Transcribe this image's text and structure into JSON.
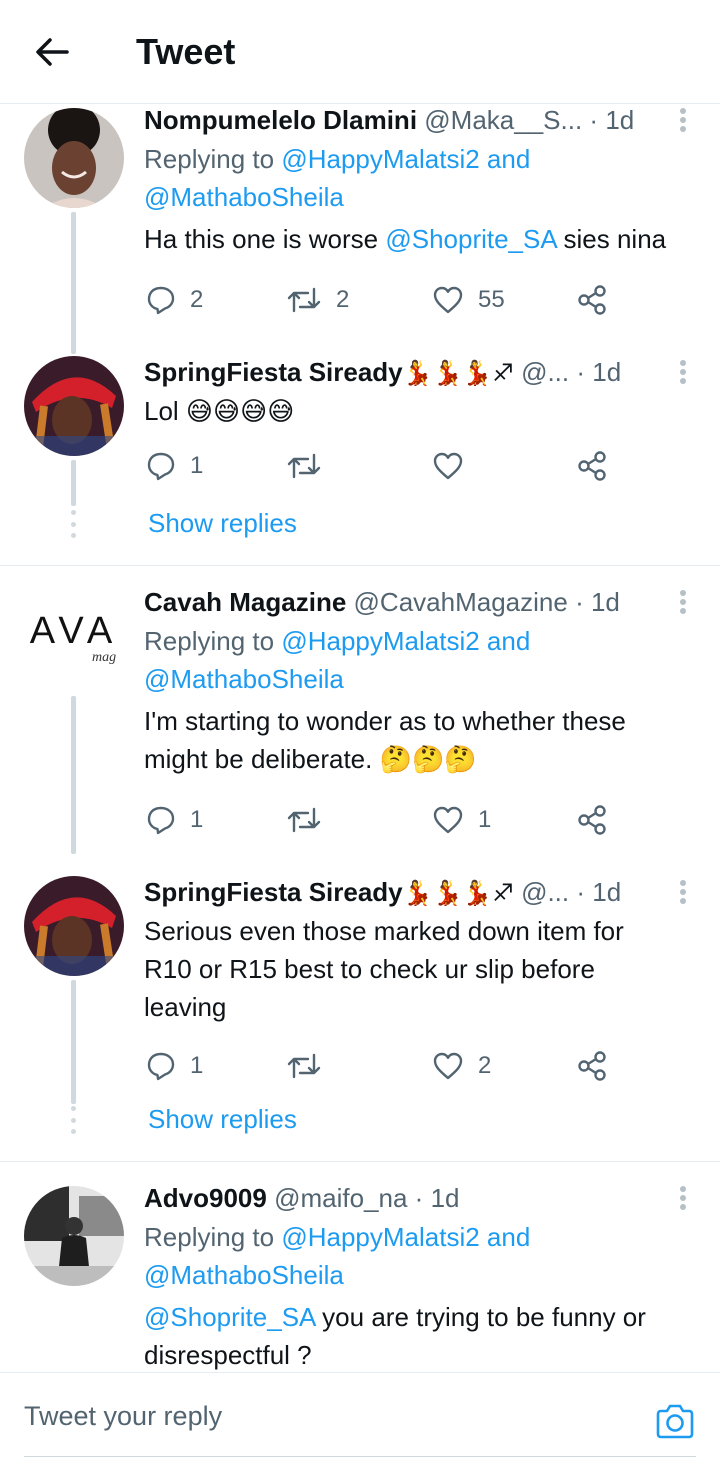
{
  "header": {
    "title": "Tweet"
  },
  "tweets": [
    {
      "name": "Nompumelelo Dlamini",
      "handle": "@Maka__S...",
      "time": "1d",
      "reply_prefix": "Replying to ",
      "reply_1": "@HappyMalatsi2",
      "reply_and": " and",
      "reply_2": "@MathaboSheila",
      "text_a": "Ha this one is worse ",
      "text_mention": "@Shoprite_SA",
      "text_b": " sies nina",
      "replies": "2",
      "retweets": "2",
      "likes": "55"
    },
    {
      "name": "SpringFiesta Siready",
      "emoji": "💃💃💃♐",
      "handle": "@...",
      "time": "1d",
      "text": "Lol 😅😅😅😅",
      "replies": "1",
      "retweets": "",
      "likes": "",
      "show_replies": "Show replies"
    },
    {
      "name": "Cavah Magazine",
      "handle": "@CavahMagazine",
      "time": "1d",
      "avatar_text": "AVA",
      "avatar_sub": "mag",
      "reply_prefix": "Replying to ",
      "reply_1": "@HappyMalatsi2",
      "reply_and": " and",
      "reply_2": "@MathaboSheila",
      "text_1": "I'm starting to wonder as to whether these",
      "text_2": "might be deliberate. 🤔🤔🤔",
      "replies": "1",
      "retweets": "",
      "likes": "1"
    },
    {
      "name": "SpringFiesta Siready",
      "emoji": "💃💃💃♐",
      "handle": "@...",
      "time": "1d",
      "text_1": "Serious even those marked down item for",
      "text_2": "R10 or R15 best to check ur slip before",
      "text_3": "leaving",
      "replies": "1",
      "retweets": "",
      "likes": "2",
      "show_replies": "Show replies"
    },
    {
      "name": "Advo9009",
      "handle": "@maifo_na",
      "time": "1d",
      "reply_prefix": "Replying to ",
      "reply_1": "@HappyMalatsi2",
      "reply_and": " and",
      "reply_2": "@MathaboSheila",
      "text_mention": "@Shoprite_SA",
      "text_a": " you are trying to be funny or",
      "text_2": "disrespectful ?"
    }
  ],
  "reply_bar": {
    "placeholder": "Tweet your reply"
  },
  "colors": {
    "accent": "#1d9bf0",
    "muted": "#536471",
    "divider": "#e6ecf0"
  }
}
